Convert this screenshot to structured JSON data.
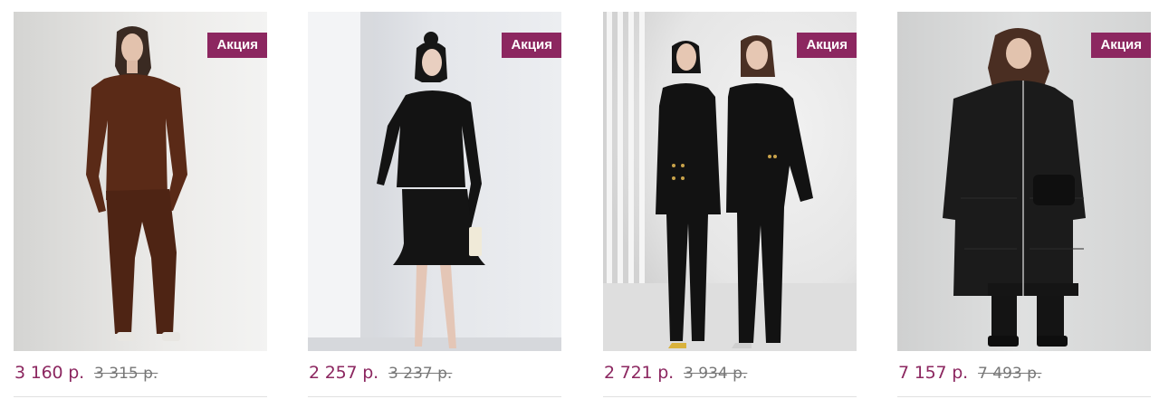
{
  "products": [
    {
      "badge": "Акция",
      "price": "3 160 р.",
      "old_price": "3 315 р.",
      "image": "woman-in-brown-knit-tracksuit",
      "accent_color": "#5a2a17"
    },
    {
      "badge": "Акция",
      "price": "2 257 р.",
      "old_price": "3 237 р.",
      "image": "woman-in-black-jacket-and-skirt",
      "accent_color": "#141414"
    },
    {
      "badge": "Акция",
      "price": "2 721 р.",
      "old_price": "3 934 р.",
      "image": "two-women-in-black-pantsuits",
      "accent_color": "#141414"
    },
    {
      "badge": "Акция",
      "price": "7 157 р.",
      "old_price": "7 493 р.",
      "image": "woman-in-black-long-puffer-coat",
      "accent_color": "#1a1a1a"
    }
  ],
  "colors": {
    "badge_bg": "#8c2760",
    "price": "#8c2760",
    "old_price": "#777777",
    "divider": "#e1e1e1"
  }
}
